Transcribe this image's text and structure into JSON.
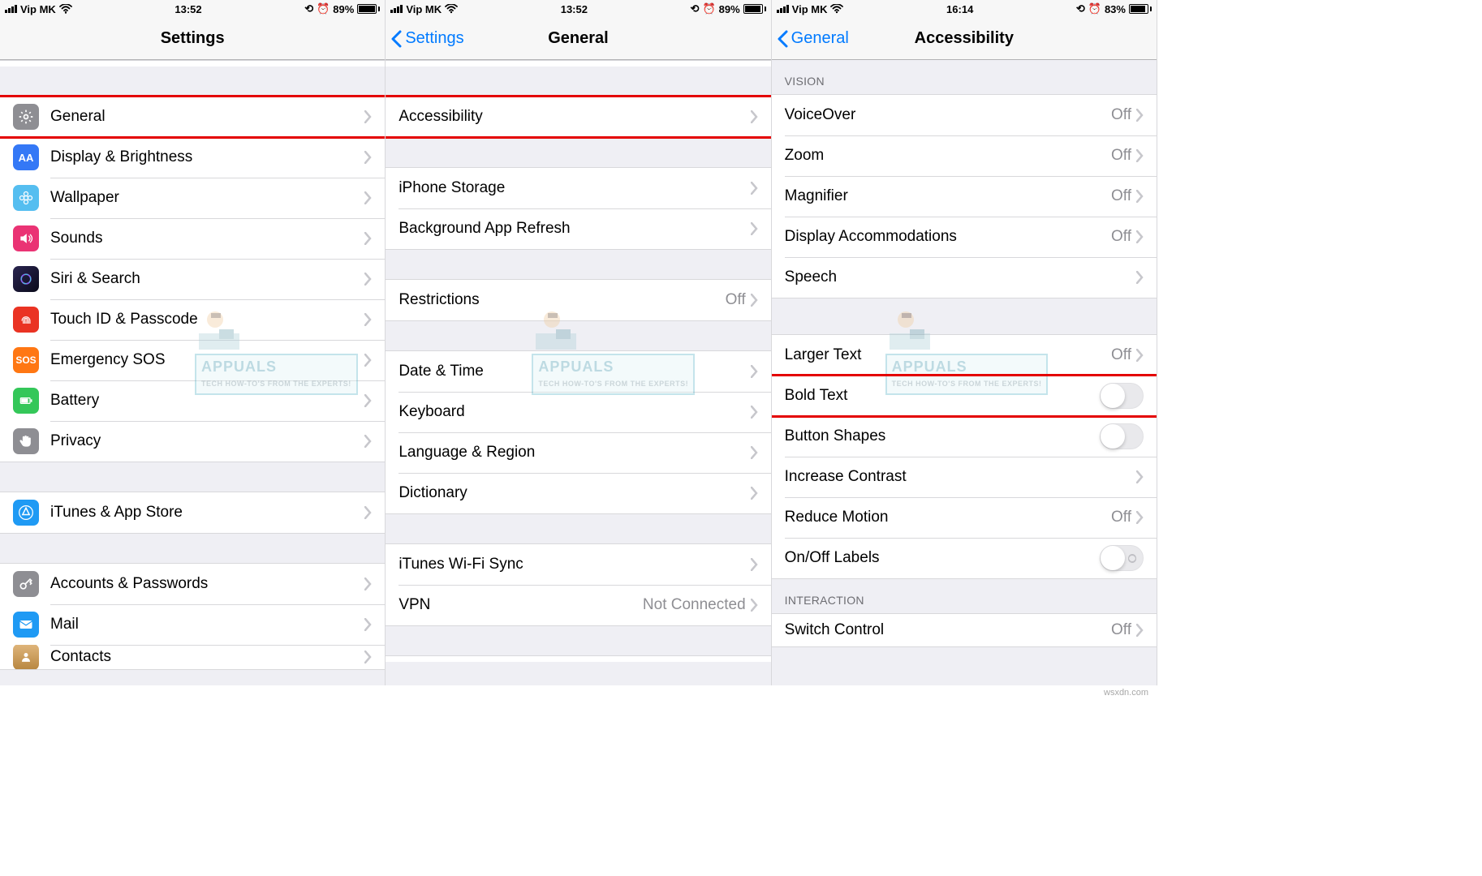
{
  "attribution": "wsxdn.com",
  "watermark": {
    "brand": "APPUALS",
    "tag": "TECH HOW-TO'S FROM THE EXPERTS!"
  },
  "panes": [
    {
      "status": {
        "carrier": "Vip MK",
        "time": "13:52",
        "battery": "89%"
      },
      "nav": {
        "title": "Settings",
        "back": null
      },
      "groups": [
        {
          "partial_top": true,
          "rows": []
        },
        {
          "rows": [
            {
              "icon": "gear",
              "bg": "#8e8e93",
              "label": "General",
              "highlight": true,
              "withIcon": true
            },
            {
              "icon": "AA",
              "bg": "#3478f6",
              "label": "Display & Brightness",
              "withIcon": true
            },
            {
              "icon": "rosette",
              "bg": "#55bef0",
              "label": "Wallpaper",
              "withIcon": true
            },
            {
              "icon": "speaker",
              "bg": "#ea3374",
              "label": "Sounds",
              "withIcon": true
            },
            {
              "icon": "siri",
              "bg": "#1b1b2f",
              "label": "Siri & Search",
              "withIcon": true
            },
            {
              "icon": "finger",
              "bg": "#ea3323",
              "label": "Touch ID & Passcode",
              "withIcon": true
            },
            {
              "icon": "SOS",
              "bg": "#ff7713",
              "label": "Emergency SOS",
              "withIcon": true
            },
            {
              "icon": "battery",
              "bg": "#34c759",
              "label": "Battery",
              "withIcon": true
            },
            {
              "icon": "hand",
              "bg": "#8e8e93",
              "label": "Privacy",
              "withIcon": true
            }
          ]
        },
        {
          "rows": [
            {
              "icon": "appstore",
              "bg": "#1f9af4",
              "label": "iTunes & App Store",
              "withIcon": true
            }
          ]
        },
        {
          "rows": [
            {
              "icon": "key",
              "bg": "#8e8e93",
              "label": "Accounts & Passwords",
              "withIcon": true
            },
            {
              "icon": "mail",
              "bg": "#1f9af4",
              "label": "Mail",
              "withIcon": true
            },
            {
              "icon": "contacts",
              "bg": "#d6a45b",
              "label": "Contacts",
              "withIcon": true,
              "cut": true
            }
          ]
        }
      ]
    },
    {
      "status": {
        "carrier": "Vip MK",
        "time": "13:52",
        "battery": "89%"
      },
      "nav": {
        "title": "General",
        "back": "Settings"
      },
      "groups": [
        {
          "partial_top": true,
          "rows": []
        },
        {
          "rows": [
            {
              "label": "Accessibility",
              "highlight": true
            }
          ]
        },
        {
          "rows": [
            {
              "label": "iPhone Storage"
            },
            {
              "label": "Background App Refresh"
            }
          ]
        },
        {
          "rows": [
            {
              "label": "Restrictions",
              "value": "Off"
            }
          ]
        },
        {
          "rows": [
            {
              "label": "Date & Time"
            },
            {
              "label": "Keyboard"
            },
            {
              "label": "Language & Region"
            },
            {
              "label": "Dictionary"
            }
          ]
        },
        {
          "rows": [
            {
              "label": "iTunes Wi-Fi Sync"
            },
            {
              "label": "VPN",
              "value": "Not Connected"
            }
          ]
        },
        {
          "partial_top": true,
          "rows": []
        }
      ]
    },
    {
      "status": {
        "carrier": "Vip MK",
        "time": "16:14",
        "battery": "83%"
      },
      "nav": {
        "title": "Accessibility",
        "back": "General"
      },
      "groups": [
        {
          "header": "VISION",
          "rows": [
            {
              "label": "VoiceOver",
              "value": "Off"
            },
            {
              "label": "Zoom",
              "value": "Off"
            },
            {
              "label": "Magnifier",
              "value": "Off"
            },
            {
              "label": "Display Accommodations",
              "value": "Off"
            },
            {
              "label": "Speech"
            }
          ]
        },
        {
          "rows": [
            {
              "label": "Larger Text",
              "value": "Off"
            },
            {
              "label": "Bold Text",
              "toggle": true,
              "highlight": true
            },
            {
              "label": "Button Shapes",
              "toggle": true
            },
            {
              "label": "Increase Contrast"
            },
            {
              "label": "Reduce Motion",
              "value": "Off"
            },
            {
              "label": "On/Off Labels",
              "toggle": true,
              "toggleLabels": true
            }
          ]
        },
        {
          "header": "INTERACTION",
          "rows": [
            {
              "label": "Switch Control",
              "value": "Off",
              "cut": true
            }
          ]
        }
      ]
    }
  ]
}
